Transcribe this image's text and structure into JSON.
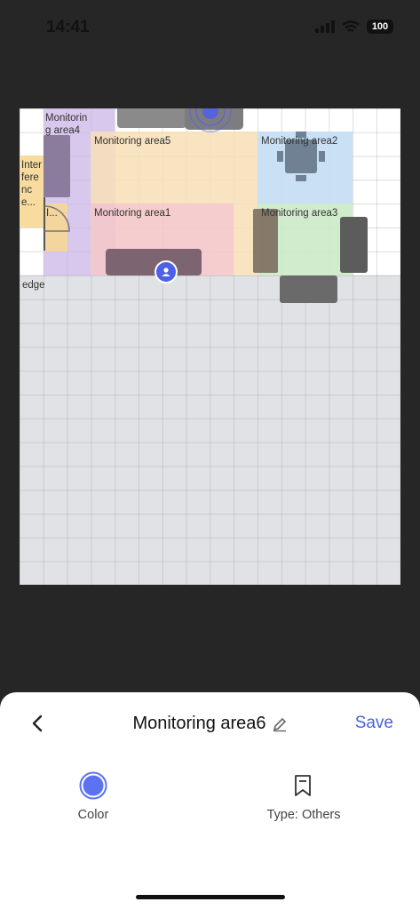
{
  "status_bar": {
    "time": "14:41",
    "battery": "100"
  },
  "map": {
    "zones": [
      {
        "label": "Monitoring area4",
        "color": "#cbb6e8"
      },
      {
        "label": "Monitoring area5",
        "color": "#f8dfb6"
      },
      {
        "label": "Monitoring area2",
        "color": "#c4def4"
      },
      {
        "label": "Interference...",
        "color": "#f6d795"
      },
      {
        "label": "I...",
        "color": "#f6d795"
      },
      {
        "label": "Monitoring area1",
        "color": "#f4c8ca"
      },
      {
        "label": "Monitoring area3",
        "color": "#cceac8"
      }
    ],
    "edge_label": "edge",
    "outside_color": "#e1e2e6"
  },
  "sheet": {
    "title": "Monitoring area6",
    "save_label": "Save",
    "color_label": "Color",
    "type_label": "Type: Others",
    "color_value": "#5b73f0"
  },
  "icons": {
    "back": "chevron-left-icon",
    "edit": "pencil-icon",
    "bookmark": "bookmark-icon",
    "signal": "signal-icon",
    "wifi": "wifi-icon",
    "battery": "battery-icon",
    "user": "user-icon"
  }
}
